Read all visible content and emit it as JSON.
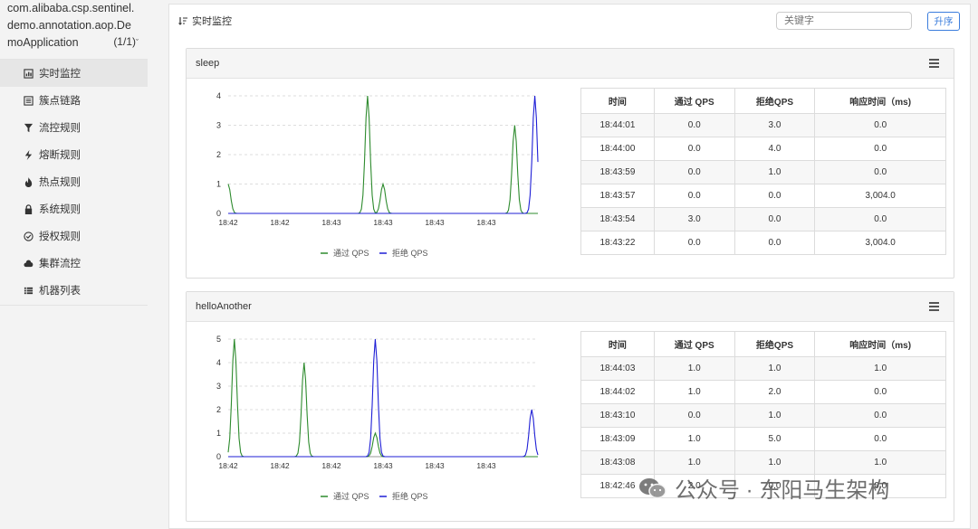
{
  "sidebar": {
    "app_name": "com.alibaba.csp.sentinel.demo.annotation.aop.DemoApplication",
    "app_count": "(1/1)",
    "items": [
      {
        "label": "实时监控",
        "icon": "bar-chart-icon"
      },
      {
        "label": "簇点链路",
        "icon": "list-icon"
      },
      {
        "label": "流控规则",
        "icon": "filter-icon"
      },
      {
        "label": "熔断规则",
        "icon": "bolt-icon"
      },
      {
        "label": "热点规则",
        "icon": "fire-icon"
      },
      {
        "label": "系统规则",
        "icon": "lock-icon"
      },
      {
        "label": "授权规则",
        "icon": "check-circle-icon"
      },
      {
        "label": "集群流控",
        "icon": "cloud-icon"
      },
      {
        "label": "机器列表",
        "icon": "table-list-icon"
      }
    ]
  },
  "main": {
    "title": "实时监控",
    "search_placeholder": "关键字",
    "sort_label": "升序"
  },
  "resources": [
    {
      "name": "sleep",
      "table": {
        "headers": [
          "时间",
          "通过 QPS",
          "拒绝QPS",
          "响应时间（ms)"
        ],
        "rows": [
          [
            "18:44:01",
            "0.0",
            "3.0",
            "0.0"
          ],
          [
            "18:44:00",
            "0.0",
            "4.0",
            "0.0"
          ],
          [
            "18:43:59",
            "0.0",
            "1.0",
            "0.0"
          ],
          [
            "18:43:57",
            "0.0",
            "0.0",
            "3,004.0"
          ],
          [
            "18:43:54",
            "3.0",
            "0.0",
            "0.0"
          ],
          [
            "18:43:22",
            "0.0",
            "0.0",
            "3,004.0"
          ]
        ]
      }
    },
    {
      "name": "helloAnother",
      "table": {
        "headers": [
          "时间",
          "通过 QPS",
          "拒绝QPS",
          "响应时间（ms)"
        ],
        "rows": [
          [
            "18:44:03",
            "1.0",
            "1.0",
            "1.0"
          ],
          [
            "18:44:02",
            "1.0",
            "2.0",
            "0.0"
          ],
          [
            "18:43:10",
            "0.0",
            "1.0",
            "0.0"
          ],
          [
            "18:43:09",
            "1.0",
            "5.0",
            "0.0"
          ],
          [
            "18:43:08",
            "1.0",
            "1.0",
            "1.0"
          ],
          [
            "18:42:46",
            "2.0",
            "0.0",
            "0.0"
          ]
        ]
      }
    }
  ],
  "chart_data": [
    {
      "type": "line",
      "x_ticks": [
        "18:42",
        "18:42",
        "18:43",
        "18:43",
        "18:43",
        "18:43"
      ],
      "y_ticks": [
        "0",
        "1",
        "2",
        "3",
        "4"
      ],
      "ylim": [
        0,
        4
      ],
      "grid": true,
      "legend_position": "bottom",
      "series": [
        {
          "name": "通过 QPS",
          "color": "#2e8b2e",
          "spikes": [
            {
              "x": 0.0,
              "y": 1
            },
            {
              "x": 0.45,
              "y": 4
            },
            {
              "x": 0.5,
              "y": 1
            },
            {
              "x": 0.925,
              "y": 3
            }
          ]
        },
        {
          "name": "拒绝 QPS",
          "color": "#1f1fd6",
          "spikes": [
            {
              "x": 0.99,
              "y": 4
            }
          ]
        }
      ]
    },
    {
      "type": "line",
      "x_ticks": [
        "18:42",
        "18:42",
        "18:42",
        "18:43",
        "18:43",
        "18:43"
      ],
      "y_ticks": [
        "0",
        "1",
        "2",
        "3",
        "4",
        "5"
      ],
      "ylim": [
        0,
        5
      ],
      "grid": true,
      "legend_position": "bottom",
      "series": [
        {
          "name": "通过 QPS",
          "color": "#2e8b2e",
          "spikes": [
            {
              "x": 0.02,
              "y": 5
            },
            {
              "x": 0.245,
              "y": 4
            },
            {
              "x": 0.475,
              "y": 1
            }
          ]
        },
        {
          "name": "拒绝 QPS",
          "color": "#1f1fd6",
          "spikes": [
            {
              "x": 0.475,
              "y": 5
            },
            {
              "x": 0.98,
              "y": 2
            }
          ]
        }
      ]
    }
  ],
  "watermark": {
    "text": "公众号 · 东阳马生架构"
  }
}
